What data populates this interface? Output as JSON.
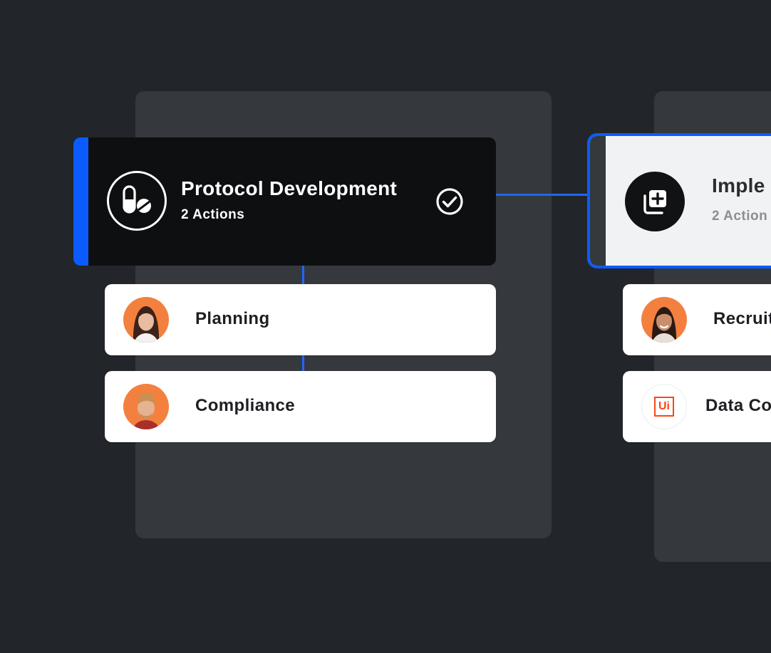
{
  "stages": [
    {
      "title": "Protocol Development",
      "subtitle": "2 Actions",
      "icon": "pills-icon",
      "status_icon": "check-circle-icon",
      "actions": [
        {
          "label": "Planning",
          "avatar": "person-avatar"
        },
        {
          "label": "Compliance",
          "avatar": "person-avatar"
        }
      ]
    },
    {
      "title": "Imple",
      "subtitle": "2 Action",
      "icon": "medical-copy-icon",
      "actions": [
        {
          "label": "Recruit",
          "avatar": "person-avatar"
        },
        {
          "label": "Data Co",
          "logo_text": "Ui"
        }
      ]
    }
  ],
  "colors": {
    "background": "#22252a",
    "lane": "#35383c",
    "accent": "#0b5cff",
    "avatar_bg": "#f3803e",
    "logo": "#fa4616"
  }
}
